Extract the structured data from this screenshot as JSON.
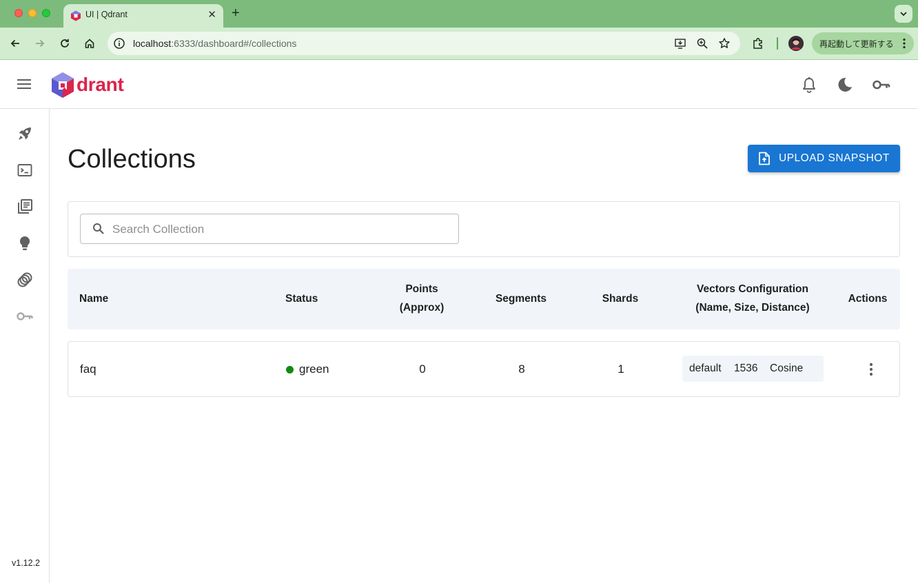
{
  "browser": {
    "tab_title": "UI | Qdrant",
    "url_host": "localhost",
    "url_rest": ":6333/dashboard#/collections",
    "update_label": "再起動して更新する"
  },
  "app": {
    "logo_text": "drant",
    "version": "v1.12.2"
  },
  "page": {
    "title": "Collections",
    "upload_label": "UPLOAD SNAPSHOT",
    "search_placeholder": "Search Collection"
  },
  "table": {
    "headers": {
      "name": "Name",
      "status": "Status",
      "points_1": "Points",
      "points_2": "(Approx)",
      "segments": "Segments",
      "shards": "Shards",
      "vectors_1": "Vectors Configuration",
      "vectors_2": "(Name, Size, Distance)",
      "actions": "Actions"
    },
    "rows": [
      {
        "name": "faq",
        "status": "green",
        "points": "0",
        "segments": "8",
        "shards": "1",
        "vector_name": "default",
        "vector_size": "1536",
        "vector_distance": "Cosine"
      }
    ]
  },
  "colors": {
    "brand": "#dc244c",
    "primary": "#1976d2",
    "status_green": "#108a10"
  },
  "icons": {
    "sidebar": [
      "rocket-icon",
      "console-icon",
      "collections-icon",
      "lightbulb-icon",
      "api-icon",
      "key-icon"
    ],
    "appbar": [
      "bell-icon",
      "moon-icon",
      "key-icon"
    ]
  }
}
